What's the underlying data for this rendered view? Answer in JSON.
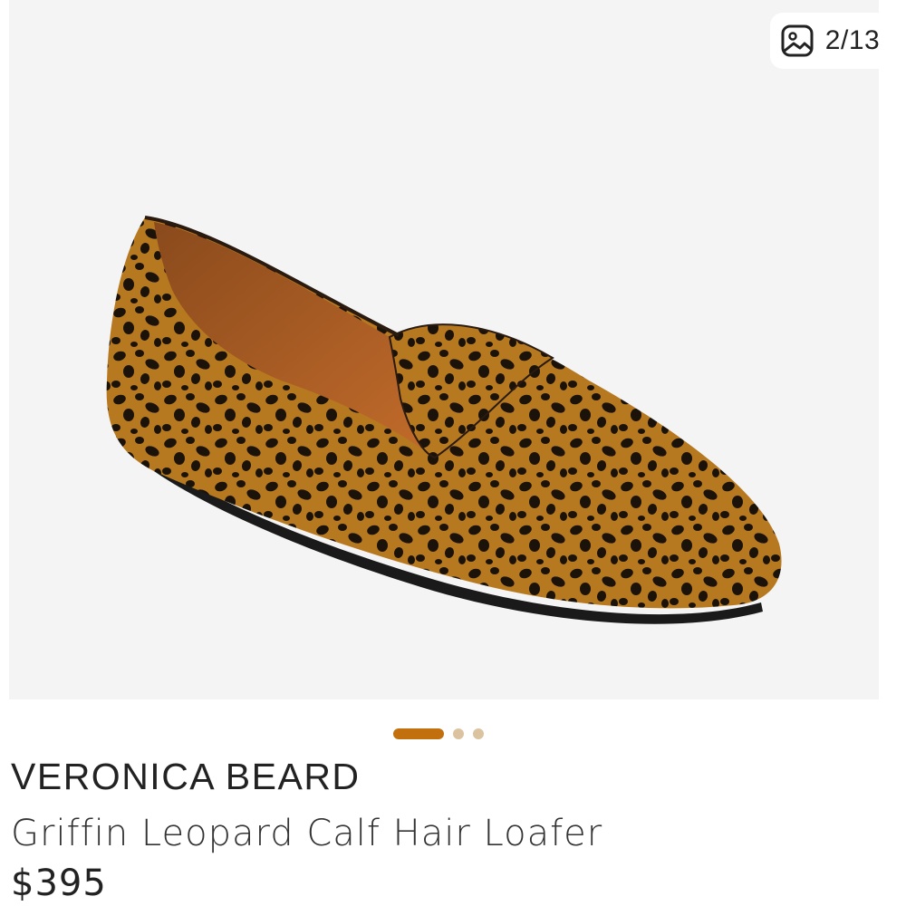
{
  "gallery": {
    "counter": "2/13",
    "image_icon": "image-icon",
    "pager": {
      "active_index": 0,
      "dots": 3
    },
    "colors": {
      "background": "#f4f4f4",
      "pager_active": "#c2700e",
      "pager_inactive": "#dcc3a0"
    }
  },
  "product": {
    "brand": "VERONICA BEARD",
    "title": "Griffin Leopard Calf Hair Loafer",
    "price": "$395"
  }
}
